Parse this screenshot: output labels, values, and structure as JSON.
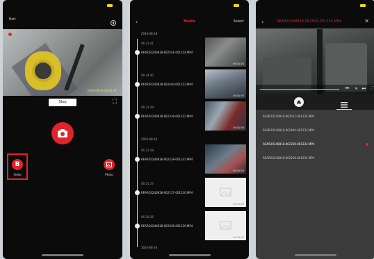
{
  "phone1": {
    "exit_label": "Exit",
    "preview_timestamp": "2024-08-18 06:25:41",
    "stop_label": "Stop",
    "video_label": "Video",
    "photo_label": "Photo"
  },
  "phone2": {
    "back_icon": "chevron-left-icon",
    "title": "Media",
    "select_label": "Select",
    "groups": [
      {
        "label": "2024-08-18"
      },
      {
        "label": "2024-08-18"
      },
      {
        "label": "2024-08-18"
      }
    ],
    "items": [
      {
        "time": "06:25:41",
        "filename": "REAR20240818-062541-001234.MP4",
        "duration": "00:01:00"
      },
      {
        "time": "06:24:40",
        "filename": "REAR20240818-062440-001233.MP4",
        "duration": "00:01:00"
      },
      {
        "time": "06:23:39",
        "filename": "REAR20240818-062339-001232.MP4",
        "duration": "00:01:00"
      },
      {
        "time": "06:22:38",
        "filename": "REAR20240818-062238-001231.MP4",
        "duration": "00:01:00"
      },
      {
        "time": "06:21:37",
        "filename": "REAR20240818-062137-001230.MP4",
        "duration": "00:01:00"
      },
      {
        "time": "06:20:36",
        "filename": "REAR20240818-062036-001229.MP4",
        "duration": "00:01:00"
      }
    ]
  },
  "phone3": {
    "title": "REAR20240818-062541-001234.MP4",
    "close_icon": "close-icon",
    "files": [
      {
        "name": "REAR20240818-062541-001234.MP4",
        "active": false
      },
      {
        "name": "REAR20240818-062440-001233.MP4",
        "active": false
      },
      {
        "name": "REAR20240818-062339-001232.MP4",
        "active": true
      },
      {
        "name": "REAR20240818-062238-001231.MP4",
        "active": false
      }
    ]
  },
  "colors": {
    "accent": "#e0242c",
    "background": "#0b0b0b",
    "panel": "#3b3b3b"
  }
}
